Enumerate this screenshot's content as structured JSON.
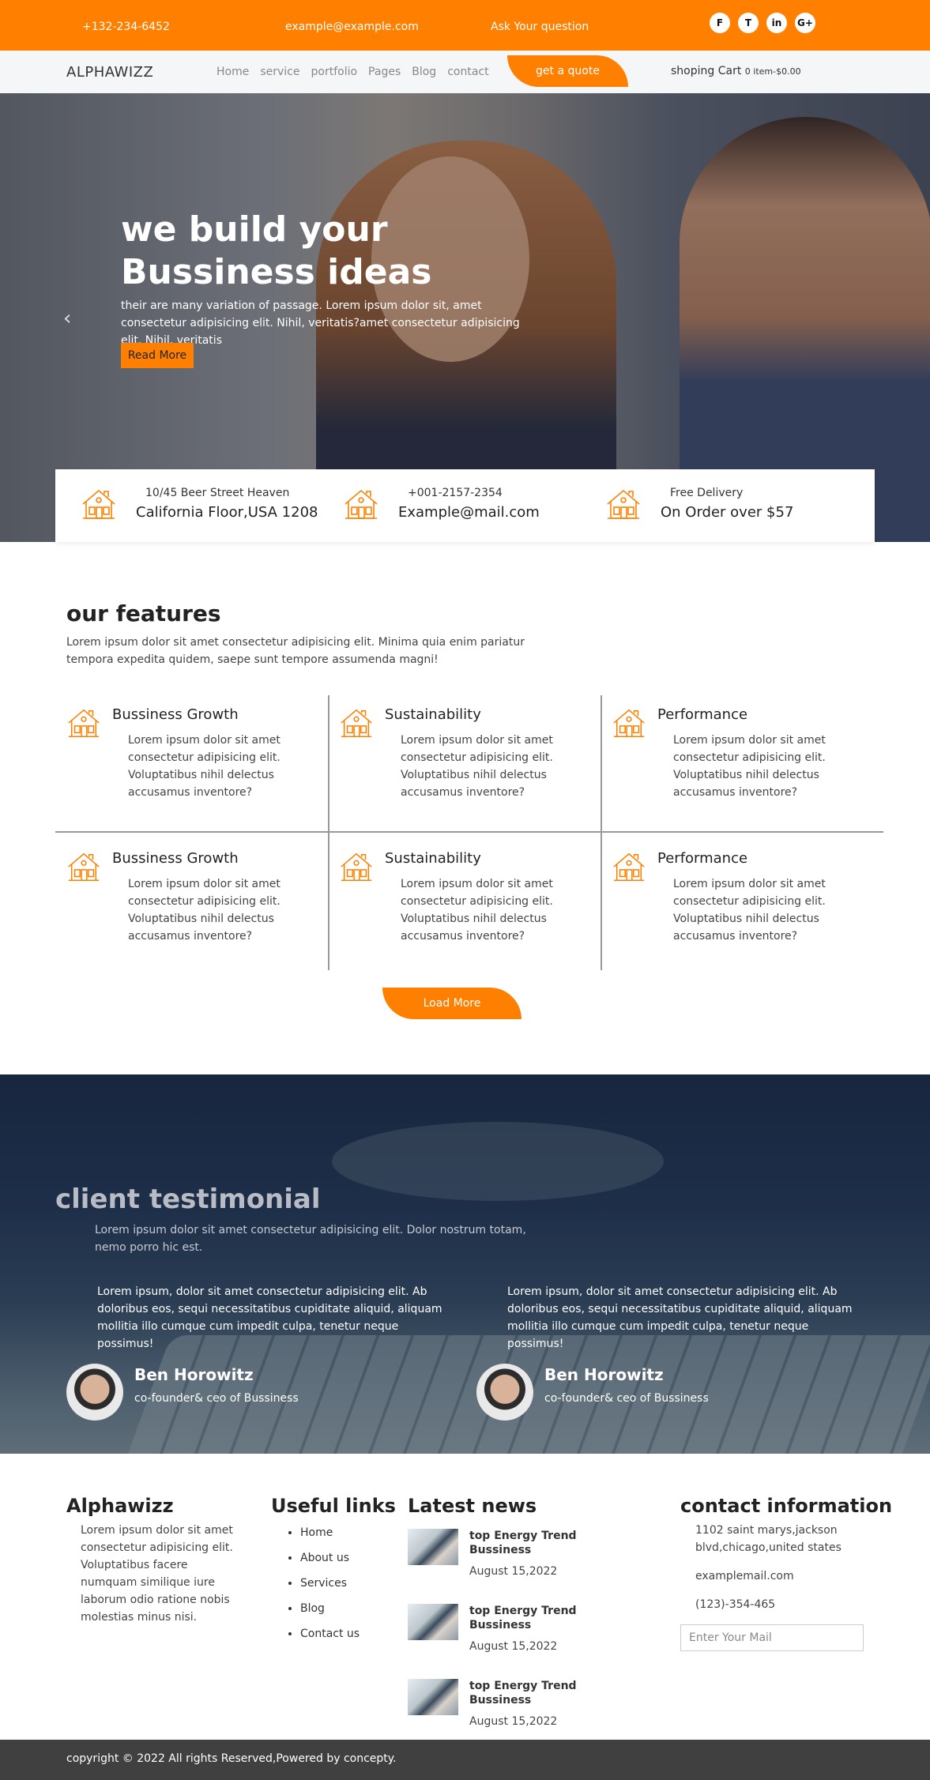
{
  "topbar": {
    "phone": "+132-234-6452",
    "email": "example@example.com",
    "ask": "Ask Your question",
    "social": [
      "F",
      "T",
      "in",
      "G+"
    ]
  },
  "nav": {
    "logo": "ALPHAWIZZ",
    "items": [
      "Home",
      "service",
      "portfolio",
      "Pages",
      "Blog",
      "contact"
    ],
    "quote": "get a quote",
    "cart_label": "shoping Cart",
    "cart_info": "0 item-$0.00"
  },
  "hero": {
    "title_line1": "we build your",
    "title_line2": "Bussiness ideas",
    "text": "their are many variation of passage. Lorem ipsum dolor sit, amet consectetur adipisicing elit. Nihil, veritatis?amet consectetur adipisicing elit. Nihil, veritatis",
    "button": "Read More",
    "prev_arrow": "‹"
  },
  "info": [
    {
      "line1": "10/45 Beer Street Heaven",
      "line2": "California Floor,USA 1208",
      "icon": "house-icon"
    },
    {
      "line1": "+001-2157-2354",
      "line2": "Example@mail.com",
      "icon": "house-icon"
    },
    {
      "line1": "Free Delivery",
      "line2": "On Order over $57",
      "icon": "house-icon"
    }
  ],
  "features": {
    "title": "our features",
    "desc": "Lorem ipsum dolor sit amet consectetur adipisicing elit. Minima quia enim pariatur tempora expedita quidem, saepe sunt tempore assumenda magni!",
    "cards": [
      {
        "title": "Bussiness Growth",
        "text": "Lorem ipsum dolor sit amet consectetur adipisicing elit. Voluptatibus nihil delectus accusamus inventore?"
      },
      {
        "title": "Sustainability",
        "text": "Lorem ipsum dolor sit amet consectetur adipisicing elit. Voluptatibus nihil delectus accusamus inventore?"
      },
      {
        "title": "Performance",
        "text": "Lorem ipsum dolor sit amet consectetur adipisicing elit. Voluptatibus nihil delectus accusamus inventore?"
      },
      {
        "title": "Bussiness Growth",
        "text": "Lorem ipsum dolor sit amet consectetur adipisicing elit. Voluptatibus nihil delectus accusamus inventore?"
      },
      {
        "title": "Sustainability",
        "text": "Lorem ipsum dolor sit amet consectetur adipisicing elit. Voluptatibus nihil delectus accusamus inventore?"
      },
      {
        "title": "Performance",
        "text": "Lorem ipsum dolor sit amet consectetur adipisicing elit. Voluptatibus nihil delectus accusamus inventore?"
      }
    ],
    "load_more": "Load More"
  },
  "testimonial": {
    "title": "client testimonial",
    "sub": "Lorem ipsum dolor sit amet consectetur adipisicing elit. Dolor nostrum totam, nemo porro hic est.",
    "items": [
      {
        "quote": "Lorem ipsum, dolor sit amet consectetur adipisicing elit. Ab doloribus eos, sequi necessitatibus cupiditate aliquid, aliquam mollitia illo cumque cum impedit culpa, tenetur neque possimus!",
        "name": "Ben Horowitz",
        "role": "co-founder& ceo of Bussiness"
      },
      {
        "quote": "Lorem ipsum, dolor sit amet consectetur adipisicing elit. Ab doloribus eos, sequi necessitatibus cupiditate aliquid, aliquam mollitia illo cumque cum impedit culpa, tenetur neque possimus!",
        "name": "Ben Horowitz",
        "role": "co-founder& ceo of Bussiness"
      }
    ]
  },
  "footer": {
    "about_title": "Alphawizz",
    "about_text": "Lorem ipsum dolor sit amet consectetur adipisicing elit. Voluptatibus facere numquam similique iure laborum odio ratione nobis molestias minus nisi.",
    "links_title": "Useful links",
    "links": [
      "Home",
      "About us",
      "Services",
      "Blog",
      "Contact us"
    ],
    "news_title": "Latest news",
    "news": [
      {
        "title": "top Energy Trend Bussiness",
        "date": "August 15,2022"
      },
      {
        "title": "top Energy Trend Bussiness",
        "date": "August 15,2022"
      },
      {
        "title": "top Energy Trend Bussiness",
        "date": "August 15,2022"
      }
    ],
    "contact_title": "contact information",
    "address": "1102 saint marys,jackson blvd,chicago,united states",
    "email": "examplemail.com",
    "phone": "(123)-354-465",
    "mail_placeholder": "Enter Your Mail"
  },
  "copyright": "copyright © 2022 All rights Reserved,Powered by concepty.",
  "colors": {
    "accent": "#ff8000",
    "footer_bar": "#404040"
  }
}
